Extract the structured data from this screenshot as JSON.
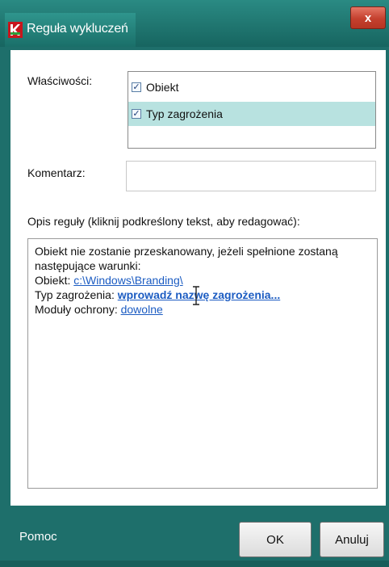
{
  "window": {
    "title": "Reguła wykluczeń",
    "close_glyph": "x"
  },
  "form": {
    "properties_label": "Właściwości:",
    "properties": [
      {
        "label": "Obiekt",
        "checked": true,
        "selected": false
      },
      {
        "label": "Typ zagrożenia",
        "checked": true,
        "selected": true
      }
    ],
    "comment_label": "Komentarz:",
    "comment_value": "",
    "description_label": "Opis reguły (kliknij podkreślony tekst, aby redagować):",
    "description": {
      "intro": "Obiekt nie zostanie przeskanowany, jeżeli spełnione zostaną następujące warunki:",
      "object_label": "Obiekt:",
      "object_link": "c:\\Windows\\Branding\\",
      "threat_label": "Typ zagrożenia:",
      "threat_link": "wprowadź nazwę zagrożenia...",
      "modules_label": "Moduły ochrony:",
      "modules_link": "dowolne"
    }
  },
  "footer": {
    "help_label": "Pomoc",
    "ok_label": "OK",
    "cancel_label": "Anuluj"
  },
  "colors": {
    "frame": "#1e6f6b",
    "selection": "#b8e2e0",
    "link": "#1c5cc2",
    "close_button": "#c4402e"
  }
}
